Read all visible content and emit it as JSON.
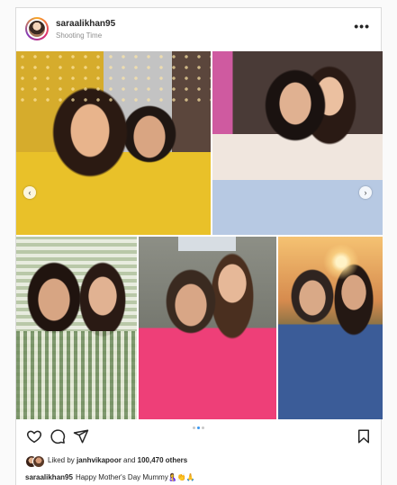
{
  "post": {
    "username": "saraalikhan95",
    "location": "Shooting Time",
    "more_label": "•••"
  },
  "media": {
    "photos": [
      {
        "desc": "photo-1"
      },
      {
        "desc": "photo-2"
      },
      {
        "desc": "photo-3"
      },
      {
        "desc": "photo-4"
      },
      {
        "desc": "photo-5"
      }
    ],
    "carousel_count": 3,
    "carousel_active": 2,
    "prev_arrow": "‹",
    "next_arrow": "›"
  },
  "actions": {
    "icons": [
      "heart-icon",
      "comment-icon",
      "share-icon",
      "bookmark-icon"
    ]
  },
  "likes": {
    "prefix": "Liked by ",
    "user": "janhvikapoor",
    "middle": " and ",
    "count": "100,470 others"
  },
  "caption": {
    "username": "saraalikhan95",
    "text": "Happy Mother's Day Mummy🤱👏🙏"
  },
  "colors": {
    "accent": "#3897f0",
    "text": "#262626",
    "muted": "#8e8e8e",
    "border": "#dbdbdb"
  }
}
